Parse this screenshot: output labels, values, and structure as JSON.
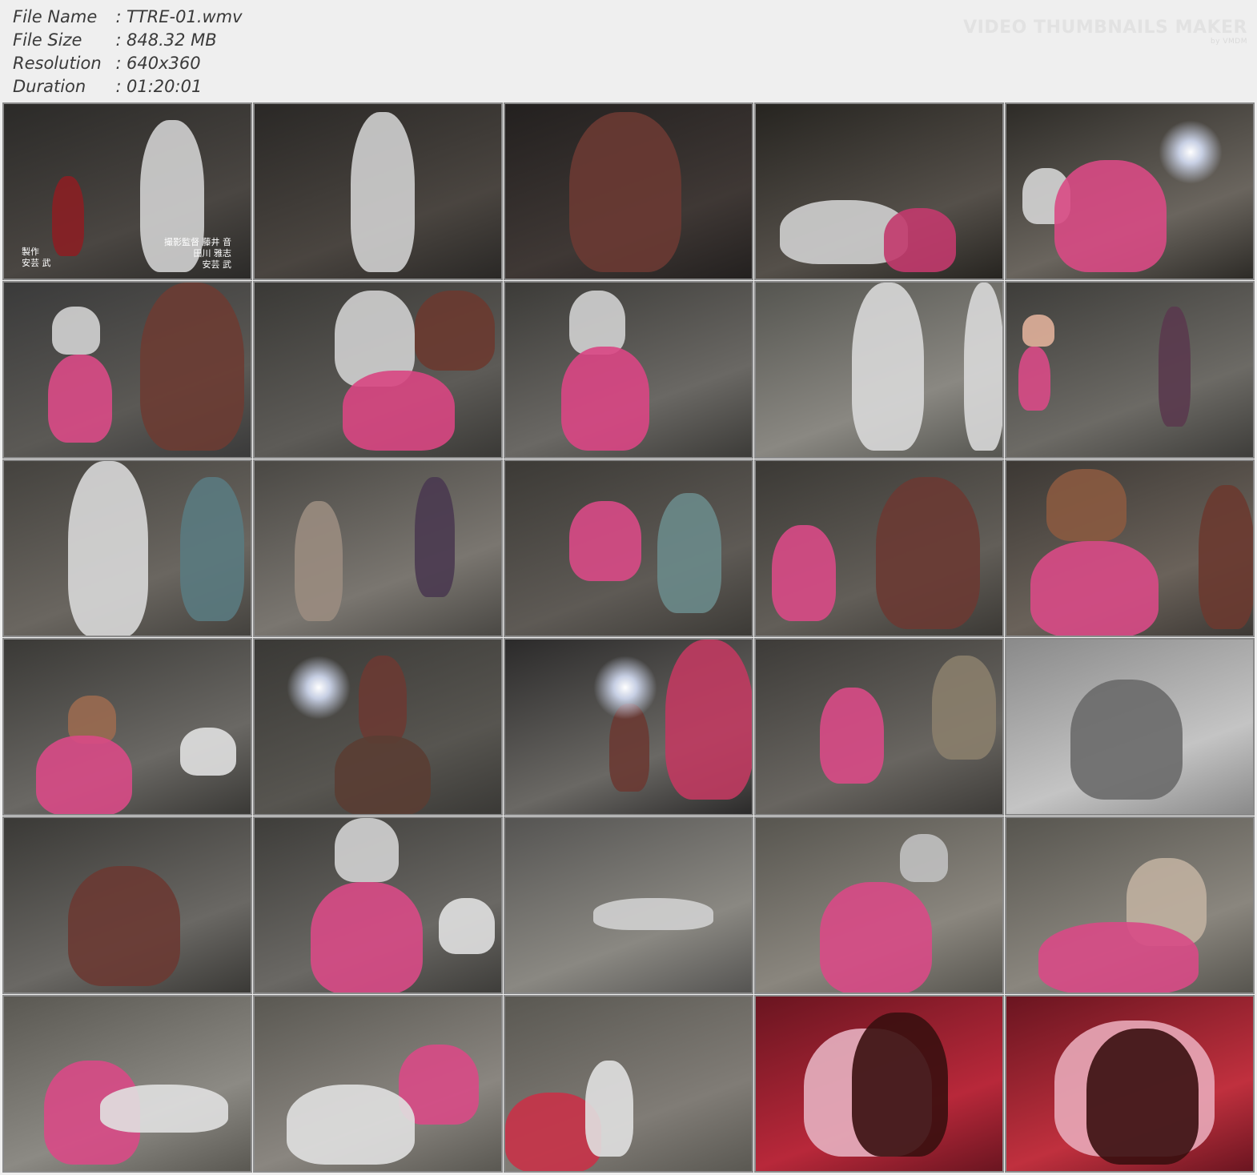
{
  "info": {
    "rows": [
      {
        "label": "File Name",
        "sep": ":",
        "value": "TTRE-01.wmv"
      },
      {
        "label": "File Size",
        "sep": ":",
        "value": "848.32 MB"
      },
      {
        "label": "Resolution",
        "sep": ":",
        "value": "640x360"
      },
      {
        "label": "Duration",
        "sep": ":",
        "value": "01:20:01"
      }
    ]
  },
  "watermark": {
    "title": "VIDEO THUMBNAILS MAKER",
    "sub": "by VMDM"
  },
  "thumbnails": {
    "count": 30,
    "first_caption_left": "製作\n安芸 武",
    "first_caption_right": "撮影監督 藤井 音\n田川 雅志\n安芸 武"
  }
}
